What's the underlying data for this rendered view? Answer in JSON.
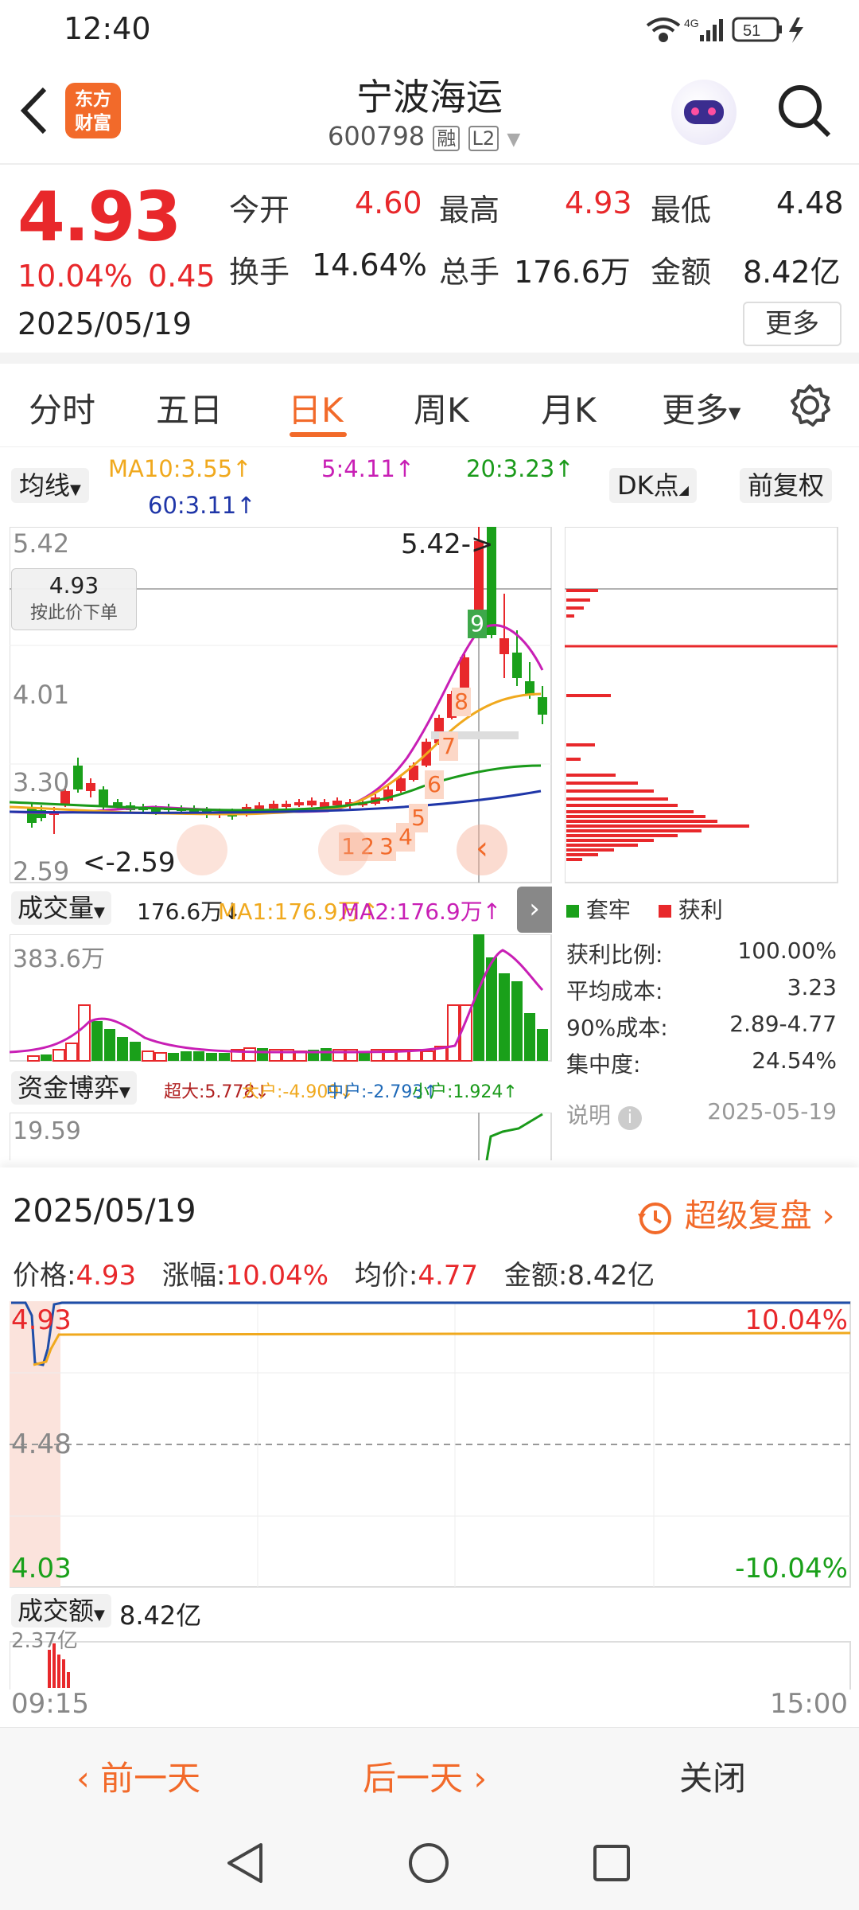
{
  "status": {
    "time": "12:40",
    "network": "4G",
    "battery": "51"
  },
  "header": {
    "title": "宁波海运",
    "code": "600798",
    "tag_margin": "融",
    "tag_level": "L2",
    "logo_line1": "东方",
    "logo_line2": "财富"
  },
  "quote": {
    "price": "4.93",
    "change_pct": "10.04%",
    "change_amt": "0.45",
    "date": "2025/05/19",
    "open_label": "今开",
    "open": "4.60",
    "high_label": "最高",
    "high": "4.93",
    "low_label": "最低",
    "low": "4.48",
    "turnover_label": "换手",
    "turnover": "14.64%",
    "volume_label": "总手",
    "volume": "176.6万",
    "amount_label": "金额",
    "amount": "8.42亿",
    "more_button": "更多"
  },
  "tabs": [
    {
      "label": "分时"
    },
    {
      "label": "五日"
    },
    {
      "label": "日K"
    },
    {
      "label": "周K"
    },
    {
      "label": "月K"
    },
    {
      "label": "更多"
    }
  ],
  "kline": {
    "ma_select": "均线",
    "ma10": "MA10:3.55↑",
    "ma5": "5:4.11↑",
    "ma20": "20:3.23↑",
    "ma60": "60:3.11↑",
    "dk_button": "DK点",
    "fq_button": "前复权",
    "price_high": "5.42",
    "price_mid": "4.01",
    "price_low_mid": "3.30",
    "price_low": "2.59",
    "cross_price": "4.93",
    "cross_hint": "按此价下单",
    "max_mark": "5.42->",
    "min_mark": "<-2.59",
    "seq_nums": [
      "1",
      "2",
      "3",
      "4",
      "5",
      "6",
      "7",
      "8",
      "9"
    ],
    "vol_select": "成交量",
    "vol_value": "176.6万↓",
    "vol_ma1": "MA1:176.9万↑",
    "vol_ma2": "MA2:176.9万↑",
    "vol_max": "383.6万",
    "fund_select": "资金博弈",
    "fund_super": "超大:5.778↓",
    "fund_big": "大户:-4.909↓",
    "fund_mid": "中户:-2.793↑",
    "fund_small": "小户:1.924↑",
    "fund_max": "19.59",
    "colors": {
      "up": "#e8282b",
      "down": "#1aa01a",
      "ma5": "#c81fb5",
      "ma10": "#f0a91e",
      "ma20": "#1a9a1a",
      "ma60": "#1f36a8"
    }
  },
  "chip": {
    "legend_trapped": "套牢",
    "legend_profit": "获利",
    "profit_ratio_label": "获利比例:",
    "profit_ratio": "100.00%",
    "avg_cost_label": "平均成本:",
    "avg_cost": "3.23",
    "cost90_label": "90%成本:",
    "cost90": "2.89-4.77",
    "concentration_label": "集中度:",
    "concentration": "24.54%",
    "note_label": "说明",
    "note_date": "2025-05-19"
  },
  "sheet": {
    "date": "2025/05/19",
    "replay_label": "超级复盘",
    "price_label": "价格:",
    "price": "4.93",
    "chg_label": "涨幅:",
    "chg": "10.04%",
    "avg_label": "均价:",
    "avg": "4.77",
    "amt_label": "金额:",
    "amt": "8.42亿",
    "y_top": "4.93",
    "y_mid": "4.48",
    "y_bot": "4.03",
    "pct_top": "10.04%",
    "pct_bot": "-10.04%",
    "amount_select": "成交额",
    "amount_value": "8.42亿",
    "amount_max": "2.37亿",
    "time_start": "09:15",
    "time_end": "15:00"
  },
  "footer": {
    "prev": "前一天",
    "next": "后一天",
    "close": "关闭"
  }
}
